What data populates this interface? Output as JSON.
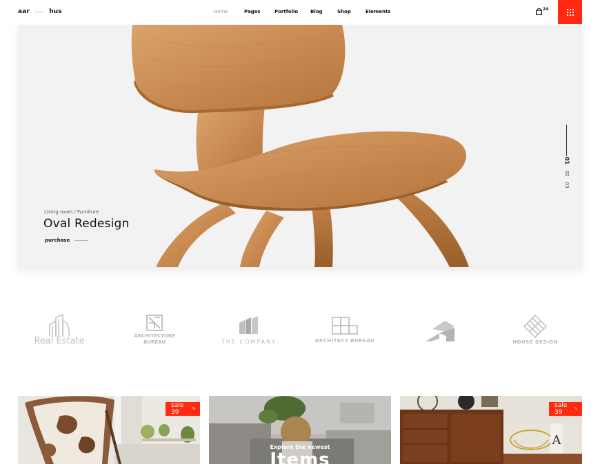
{
  "header": {
    "logo_left": "aar",
    "logo_right": "hus",
    "nav": [
      {
        "label": "Home",
        "active": true
      },
      {
        "label": "Pages"
      },
      {
        "label": "Portfolio"
      },
      {
        "label": "Blog"
      },
      {
        "label": "Shop"
      },
      {
        "label": "Elements"
      }
    ],
    "cart_count": "24",
    "accent_color": "#ff2a0f"
  },
  "hero": {
    "category": "Living room / Furniture",
    "title": "Oval Redesign",
    "link_label": "purchase",
    "slides": [
      "01",
      "02",
      "03"
    ],
    "active_slide": "01"
  },
  "brands": [
    {
      "name": "Real Estate",
      "icon": "building-icon"
    },
    {
      "name": "ARCHITECTURE\nBUREAU",
      "line1": "ARCHITECTURE",
      "line2": "BUREAU",
      "icon": "window-icon"
    },
    {
      "name": "THE COMPANY",
      "icon": "pages-icon"
    },
    {
      "name": "ARCHITECT BUREAU",
      "icon": "blocks-icon"
    },
    {
      "name": "",
      "icon": "chevron-logo-icon"
    },
    {
      "name": "HOUSE DESIGN",
      "icon": "diamond-icon"
    }
  ],
  "cards": [
    {
      "sale": "sale 39",
      "sale_sup": "%"
    },
    {
      "caption_small": "Explore the newest",
      "caption_big": "Items"
    },
    {
      "sale": "sale 39",
      "sale_sup": "%"
    }
  ]
}
